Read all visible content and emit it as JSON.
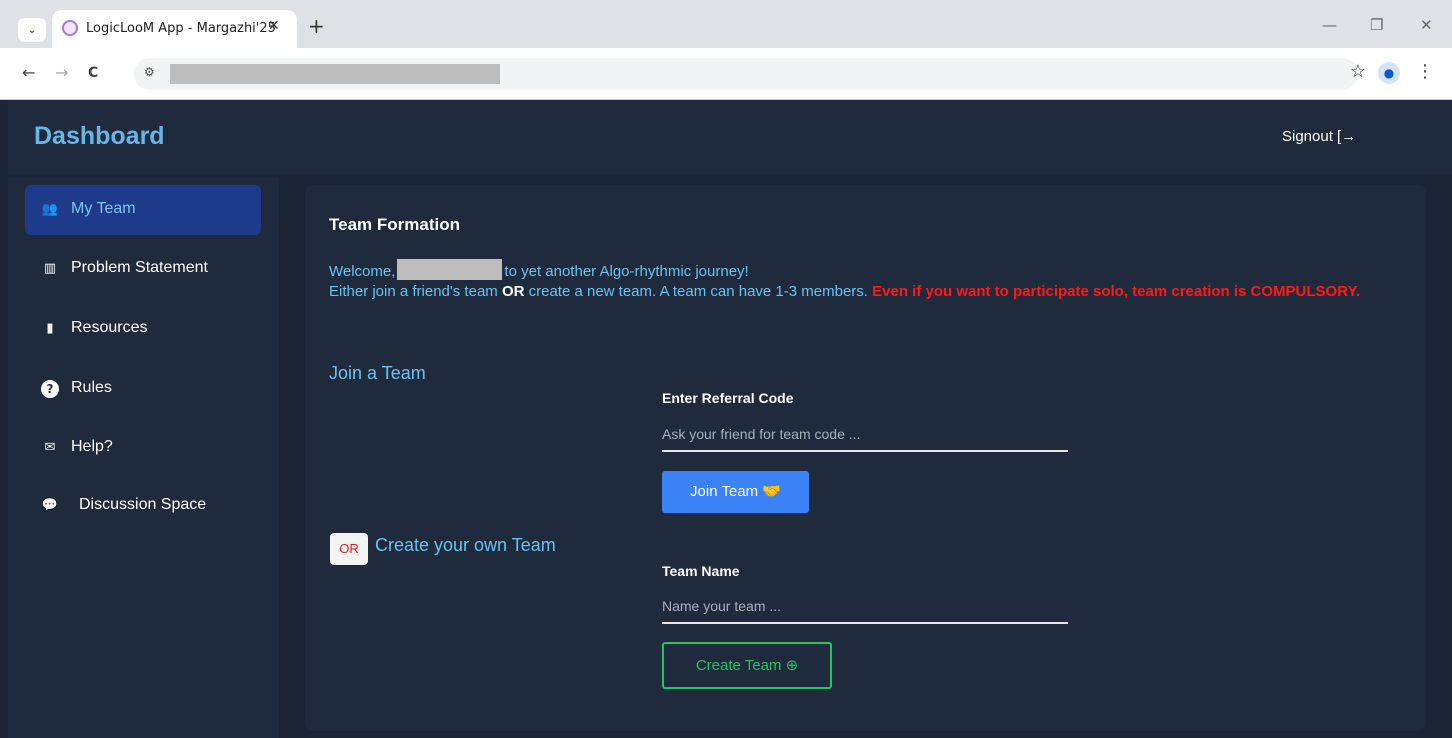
{
  "browser": {
    "tab_title": "LogicLooM App - Margazhi'25",
    "tab_close": "✕",
    "new_tab": "+",
    "tab_menu": "⌄",
    "back": "←",
    "forward": "→",
    "reload": "C",
    "bookmark": "☆",
    "menu": "⋮",
    "minimize": "—",
    "restore": "❐",
    "close": "✕"
  },
  "header": {
    "title": "Dashboard",
    "signout_label": "Signout [→"
  },
  "sidebar": {
    "items": [
      {
        "label": "My Team",
        "icon": "users-icon",
        "glyph": "👥",
        "active": true
      },
      {
        "label": "Problem Statement",
        "icon": "chart-icon",
        "glyph": "▥",
        "active": false
      },
      {
        "label": "Resources",
        "icon": "file-icon",
        "glyph": "▮",
        "active": false
      },
      {
        "label": "Rules",
        "icon": "question-icon",
        "glyph": "?",
        "active": false
      },
      {
        "label": "Help?",
        "icon": "envelope-icon",
        "glyph": "✉",
        "active": false
      },
      {
        "label": "Discussion Space",
        "icon": "comments-icon",
        "glyph": "💬",
        "active": false
      }
    ]
  },
  "main": {
    "heading": "Team Formation",
    "welcome_prefix": "Welcome,",
    "welcome_suffix": "to yet another Algo-rhythmic journey!",
    "line2_a": "Either join a friend's team",
    "line2_or": "OR",
    "line2_b": "create a new team. A team can have 1-3 members.",
    "warning": "Even if you want to participate solo, team creation is COMPULSORY.",
    "join_title": "Join a Team",
    "referral_label": "Enter Referral Code",
    "referral_placeholder": "Ask your friend for team code ...",
    "join_button": "Join Team 🤝",
    "or_badge": "OR",
    "create_title": "Create your own Team",
    "team_name_label": "Team Name",
    "team_name_placeholder": "Name your team ...",
    "create_button": "Create Team ⊕"
  }
}
